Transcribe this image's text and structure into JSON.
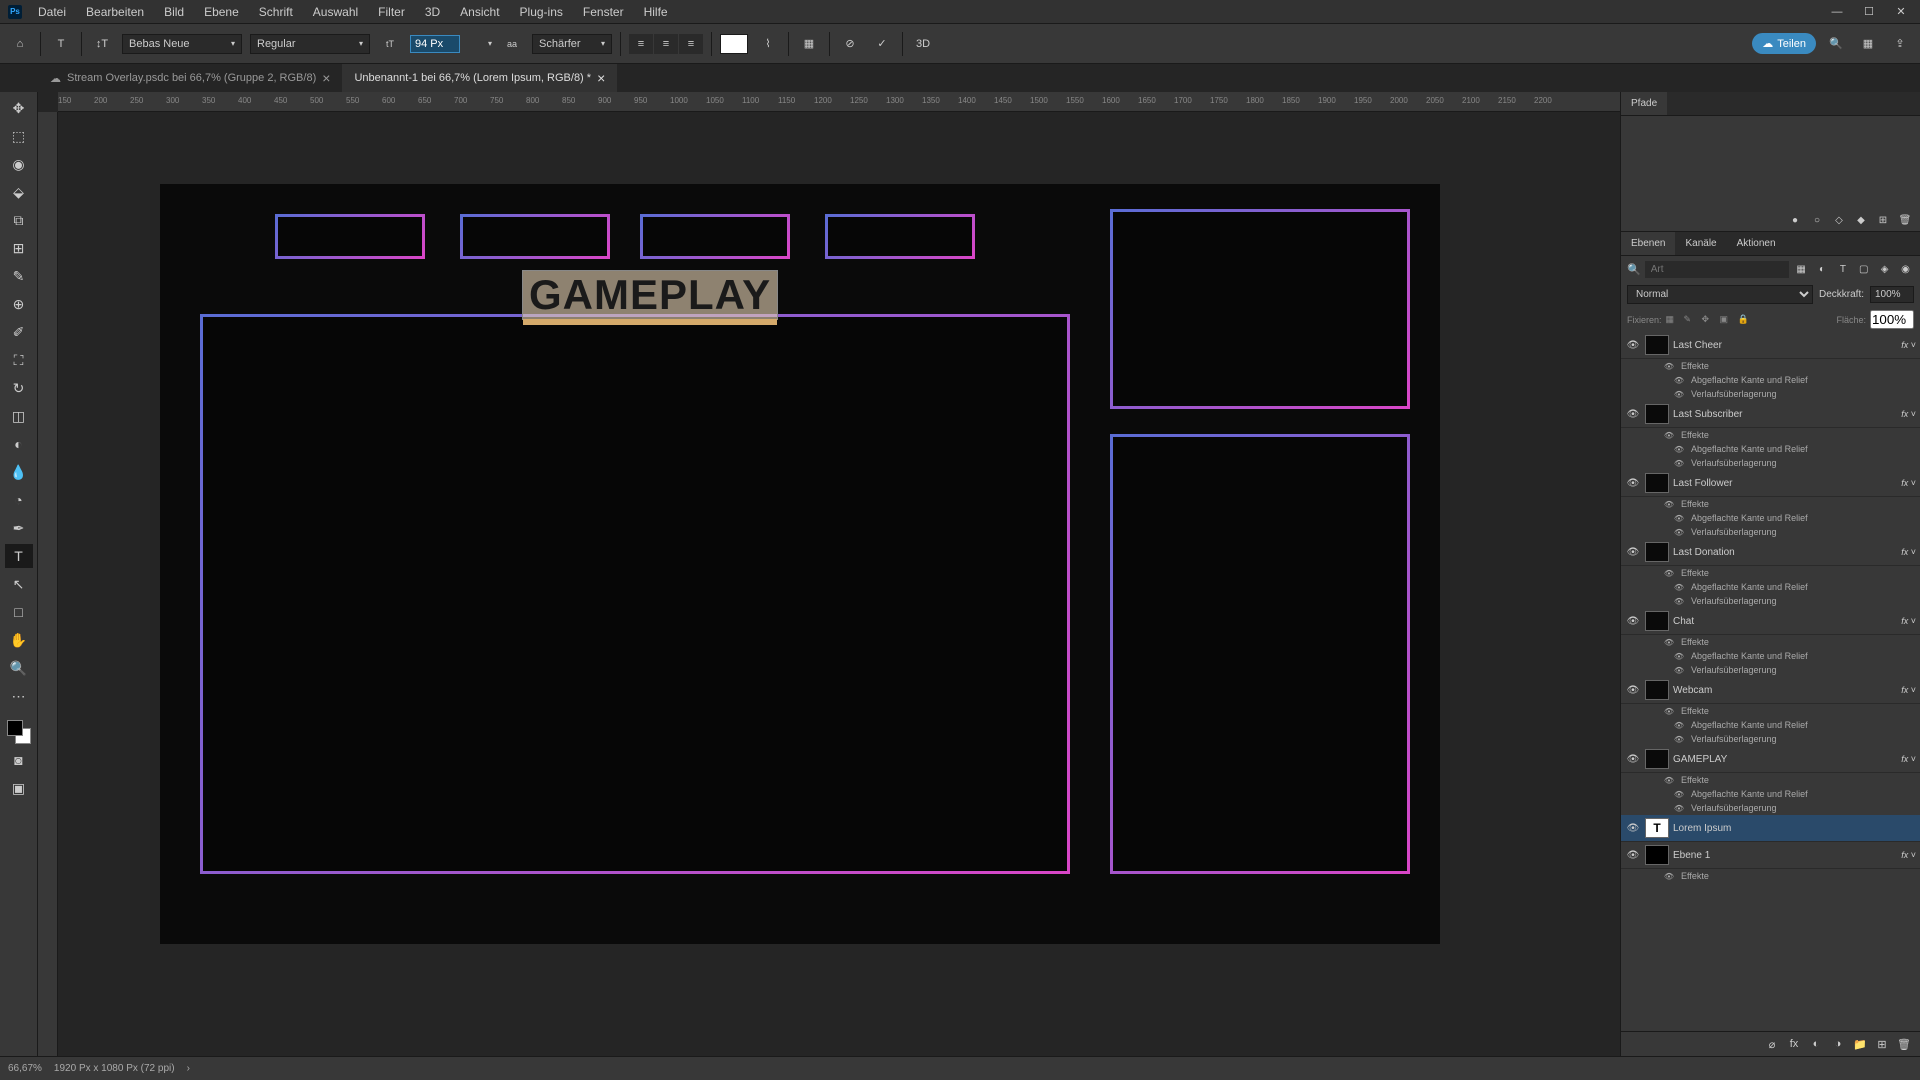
{
  "menu": {
    "items": [
      "Datei",
      "Bearbeiten",
      "Bild",
      "Ebene",
      "Schrift",
      "Auswahl",
      "Filter",
      "3D",
      "Ansicht",
      "Plug-ins",
      "Fenster",
      "Hilfe"
    ]
  },
  "options": {
    "font": "Bebas Neue",
    "weight": "Regular",
    "size": "94 Px",
    "aa": "Schärfer",
    "share": "Teilen"
  },
  "tabs": [
    {
      "label": "Stream Overlay.psdc bei 66,7% (Gruppe 2, RGB/8)",
      "active": false
    },
    {
      "label": "Unbenannt-1 bei 66,7% (Lorem Ipsum, RGB/8) *",
      "active": true
    }
  ],
  "ruler_ticks": [
    "150",
    "200",
    "250",
    "300",
    "350",
    "400",
    "450",
    "500",
    "550",
    "600",
    "650",
    "700",
    "750",
    "800",
    "850",
    "900",
    "950",
    "1000",
    "1050",
    "1100",
    "1150",
    "1200",
    "1250",
    "1300",
    "1350",
    "1400",
    "1450",
    "1500",
    "1550",
    "1600",
    "1650",
    "1700",
    "1750",
    "1800",
    "1850",
    "1900",
    "1950",
    "2000",
    "2050",
    "2100",
    "2150",
    "2200"
  ],
  "canvas": {
    "gameplay_text": "GAMEPLAY"
  },
  "panels": {
    "paths_tab": "Pfade",
    "layers_tabs": [
      "Ebenen",
      "Kanäle",
      "Aktionen"
    ],
    "search_placeholder": "Art",
    "blend_mode": "Normal",
    "opacity_label": "Deckkraft:",
    "opacity_value": "100%",
    "lock_label": "Fixieren:",
    "fill_label": "Fläche:",
    "fill_value": "100%",
    "fx_label": "Effekte",
    "fx_bevel": "Abgeflachte Kante und Relief",
    "fx_gradient": "Verlaufsüberlagerung"
  },
  "layers": [
    {
      "name": "Last Cheer",
      "fx": true
    },
    {
      "name": "Last Subscriber",
      "fx": true
    },
    {
      "name": "Last Follower",
      "fx": true
    },
    {
      "name": "Last Donation",
      "fx": true
    },
    {
      "name": "Chat",
      "fx": true
    },
    {
      "name": "Webcam",
      "fx": true
    },
    {
      "name": "GAMEPLAY",
      "fx": true
    },
    {
      "name": "Lorem Ipsum",
      "fx": false,
      "text": true,
      "selected": true
    },
    {
      "name": "Ebene 1",
      "fx": true,
      "solid": true
    }
  ],
  "status": {
    "zoom": "66,67%",
    "doc": "1920 Px x 1080 Px (72 ppi)"
  }
}
